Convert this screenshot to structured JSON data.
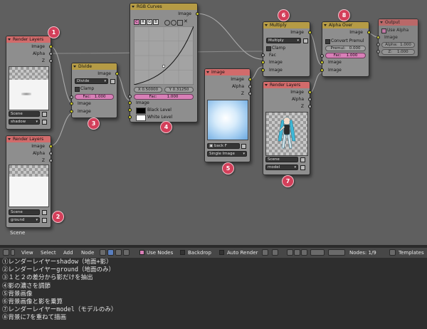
{
  "editor": {
    "scene_label": "Scene"
  },
  "nodes": {
    "render_layers_shadow": {
      "title": "Render Layers",
      "outputs": [
        "Image",
        "Alpha",
        "Z"
      ],
      "scene": "Scene",
      "layer": "shadow"
    },
    "render_layers_ground": {
      "title": "Render Layers",
      "outputs": [
        "Image",
        "Alpha",
        "Z"
      ],
      "scene": "Scene",
      "layer": "ground"
    },
    "divide": {
      "title": "Divide",
      "output": "Image",
      "mode": "Divide",
      "clamp": "Clamp",
      "fac_label": "Fac:",
      "fac_value": "1.000",
      "inputs": [
        "Image",
        "Image"
      ]
    },
    "rgb_curves": {
      "title": "RGB Curves",
      "output": "Image",
      "channels": [
        "C",
        "R",
        "G",
        "B"
      ],
      "x_value": "X 0.50000",
      "y_value": "Y 0.31250",
      "fac_label": "Fac:",
      "fac_value": "1.000",
      "inputs": [
        "Image",
        "Black Level",
        "White Level"
      ]
    },
    "image": {
      "title": "Image",
      "outputs": [
        "Image",
        "Alpha",
        "Z"
      ],
      "image_name": "back",
      "image_users": "F",
      "source": "Single Image"
    },
    "multiply": {
      "title": "Multiply",
      "output": "Image",
      "mode": "Multiply",
      "clamp": "Clamp",
      "inputs": [
        "Fac",
        "Image",
        "Image"
      ]
    },
    "render_layers_model": {
      "title": "Render Layers",
      "outputs": [
        "Image",
        "Alpha",
        "Z"
      ],
      "scene": "Scene",
      "layer": "model"
    },
    "alpha_over": {
      "title": "Alpha Over",
      "output": "Image",
      "convert_premul": "Convert Premul",
      "premul_label": "Premul:",
      "premul_value": "0.000",
      "fac_label": "Fac:",
      "fac_value": "1.000",
      "inputs": [
        "Image",
        "Image"
      ]
    },
    "output": {
      "title": "Output",
      "use_alpha": "Use Alpha",
      "input": "Image",
      "alpha_label": "Alpha:",
      "alpha_value": "1.000",
      "z_label": "Z:",
      "z_value": "1.000"
    }
  },
  "callouts": [
    "1",
    "2",
    "3",
    "4",
    "5",
    "6",
    "7",
    "8"
  ],
  "header": {
    "menus": [
      "View",
      "Select",
      "Add",
      "Node"
    ],
    "use_nodes": "Use Nodes",
    "backdrop": "Backdrop",
    "auto_render": "Auto Render",
    "nodes_count": "Nodes: 1/9",
    "templates": "Templates"
  },
  "info_lines": [
    "①レンダーレイヤーshadow（地面+影）",
    "②レンダーレイヤーground（地面のみ）",
    "③１と２の差分から影だけを抽出",
    "④影の濃さを調節",
    "⑤背景画像",
    "⑥背景画像と影を乗算",
    "⑦レンダーレイヤーmodel（モデルのみ）",
    "⑧背景に7を重ねて描画"
  ],
  "colors": {
    "header_red": "#d26b6b",
    "header_yellow": "#b59b45",
    "header_purple": "#8b6aa4",
    "callout": "#d33f5a",
    "socket_yellow": "#c9c729",
    "socket_grey": "#a3a3a3",
    "socket_blue": "#6b7bd6",
    "field_pink": "#d87fb7"
  }
}
